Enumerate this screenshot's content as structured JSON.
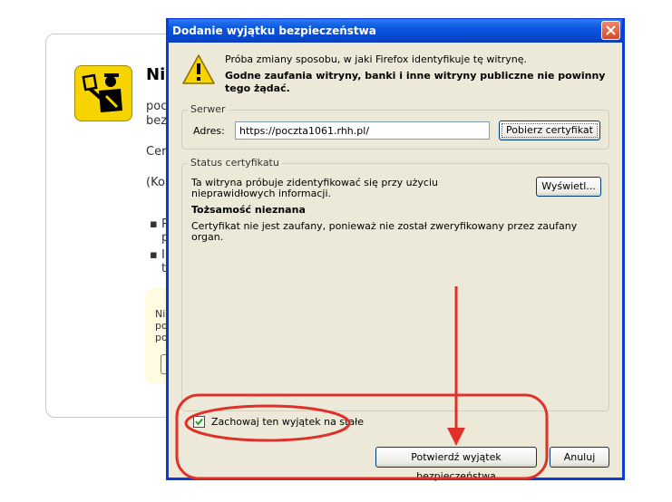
{
  "background_page": {
    "title_partial": "Ni",
    "lines": [
      "poc",
      "bez",
      "Cer",
      "(Ko"
    ],
    "bullets": [
      "P",
      "p",
      "I",
      "t"
    ],
    "yellow_lines": [
      "Ni",
      "po",
      "po"
    ]
  },
  "dialog": {
    "title": "Dodanie wyjątku bezpieczeństwa",
    "message": "Próba zmiany sposobu, w jaki Firefox identyfikuje tę witrynę.",
    "warning": "Godne zaufania witryny, banki i inne witryny publiczne nie powinny tego żądać.",
    "server": {
      "legend": "Serwer",
      "address_label": "Adres:",
      "address_value": "https://poczta1061.rhh.pl/",
      "get_cert_button": "Pobierz certyfikat"
    },
    "status": {
      "legend": "Status certyfikatu",
      "text1": "Ta witryna próbuje zidentyfikować się przy użyciu nieprawidłowych informacji.",
      "view_button": "Wyświetl...",
      "identity_heading": "Tożsamość nieznana",
      "text2": "Certyfikat nie jest zaufany, ponieważ nie został zweryfikowany przez zaufany organ."
    },
    "permanent_checkbox": {
      "label": "Zachowaj ten wyjątek na stałe",
      "checked": true
    },
    "confirm_button": "Potwierdź wyjątek bezpieczeństwa",
    "cancel_button": "Anuluj"
  },
  "colors": {
    "titlebar": "#0a55e0",
    "annotation": "#e0302a",
    "warning_icon": "#f7d300"
  },
  "icons": [
    "close-icon",
    "warning-icon",
    "checkmark-icon",
    "id-officer-icon"
  ]
}
